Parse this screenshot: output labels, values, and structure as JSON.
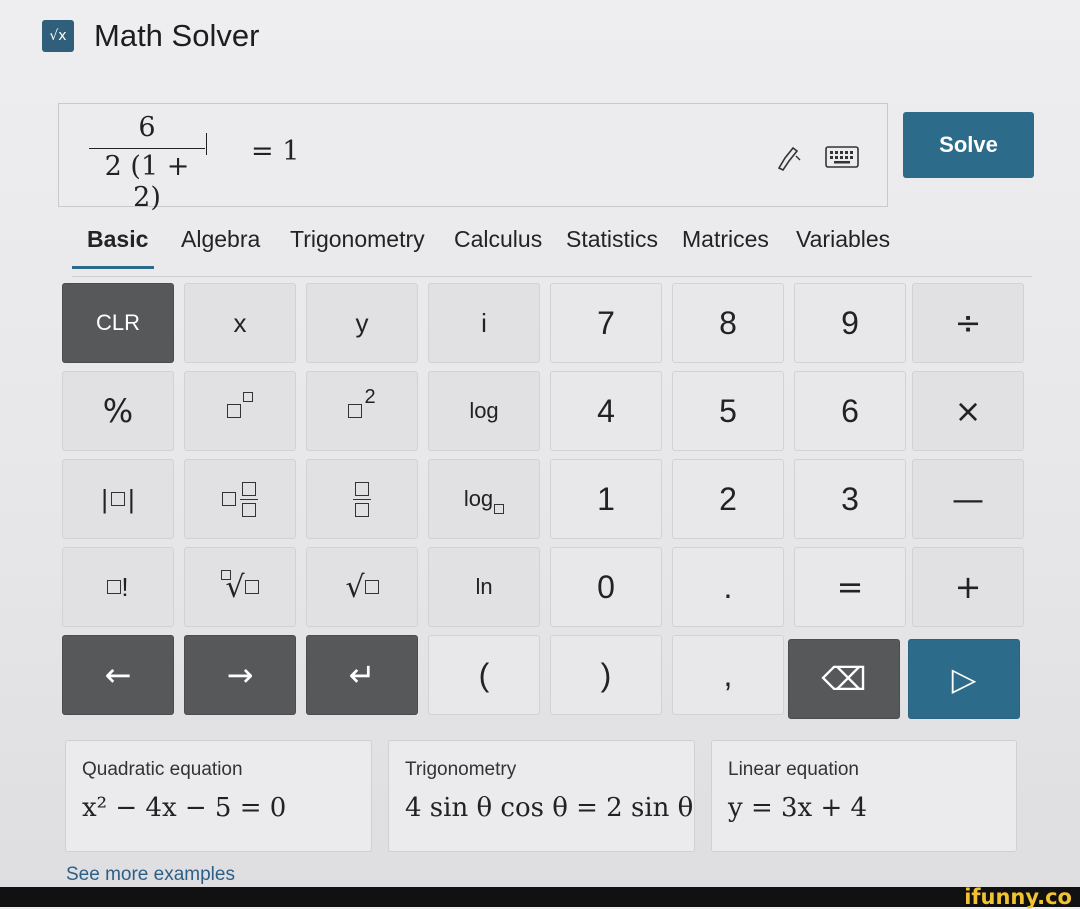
{
  "app": {
    "title": "Math Solver",
    "icon_text": "√x"
  },
  "equation": {
    "numerator": "6",
    "denominator": "2 (1 + 2)",
    "rhs": "= 1"
  },
  "toolbar": {
    "solve_label": "Solve",
    "pen_icon": "pen-icon",
    "keyboard_icon": "keyboard-icon"
  },
  "tabs": [
    "Basic",
    "Algebra",
    "Trigonometry",
    "Calculus",
    "Statistics",
    "Matrices",
    "Variables"
  ],
  "active_tab": "Basic",
  "keypad": {
    "clr": "CLR",
    "x": "x",
    "y": "y",
    "i": "i",
    "n7": "7",
    "n8": "8",
    "n9": "9",
    "divide": "÷",
    "percent": "%",
    "log": "log",
    "n4": "4",
    "n5": "5",
    "n6": "6",
    "times": "×",
    "log_base": "log",
    "n1": "1",
    "n2": "2",
    "n3": "3",
    "minus": "—",
    "factorial": "!",
    "ln": "ln",
    "n0": "0",
    "dot": ".",
    "equals": "=",
    "plus": "+",
    "left_arrow": "←",
    "right_arrow": "→",
    "enter": "↵",
    "lparen": "(",
    "rparen": ")",
    "comma": ",",
    "backspace": "⌫",
    "send": "▷",
    "square_exp": "2",
    "abs_bars": "|",
    "radical": "√"
  },
  "examples": [
    {
      "label": "Quadratic equation",
      "formula": "x² − 4x − 5 = 0"
    },
    {
      "label": "Trigonometry",
      "formula": "4 sin θ cos θ = 2 sin θ"
    },
    {
      "label": "Linear equation",
      "formula": "y = 3x + 4"
    }
  ],
  "see_more": "See more examples",
  "watermark": "ifunny.co",
  "colors": {
    "accent": "#2d6b8a",
    "dark_key": "#575859",
    "key": "#e1e1e3"
  }
}
